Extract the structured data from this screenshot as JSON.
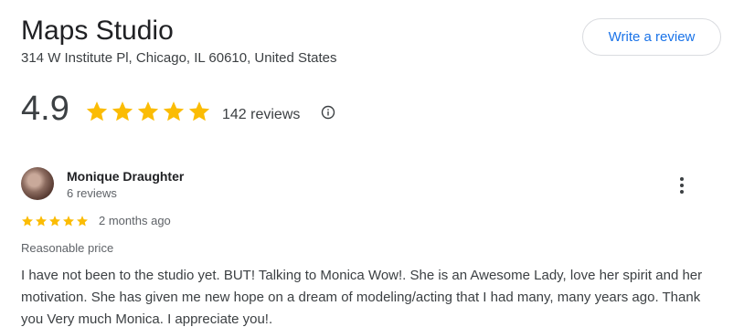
{
  "place": {
    "name": "Maps Studio",
    "address": "314 W Institute Pl, Chicago, IL 60610, United States",
    "write_review_label": "Write a review"
  },
  "rating": {
    "value": "4.9",
    "stars": 5,
    "count_label": "142 reviews",
    "info_icon": "info-icon",
    "star_color": "#fbbc04"
  },
  "review": {
    "author": "Monique Draughter",
    "author_meta": "6 reviews",
    "stars": 5,
    "date": "2 months ago",
    "tag": "Reasonable price",
    "text": "I have not been to the studio yet. BUT! Talking to Monica Wow!. She is an Awesome Lady, love her spirit and her motivation. She has given me new hope on a dream of modeling/acting that I had many, many years ago. Thank you Very much Monica. I appreciate you!.",
    "more_icon": "more-vert-icon"
  },
  "colors": {
    "accent": "#1a73e8",
    "text_primary": "#202124",
    "text_secondary": "#5f6368"
  }
}
